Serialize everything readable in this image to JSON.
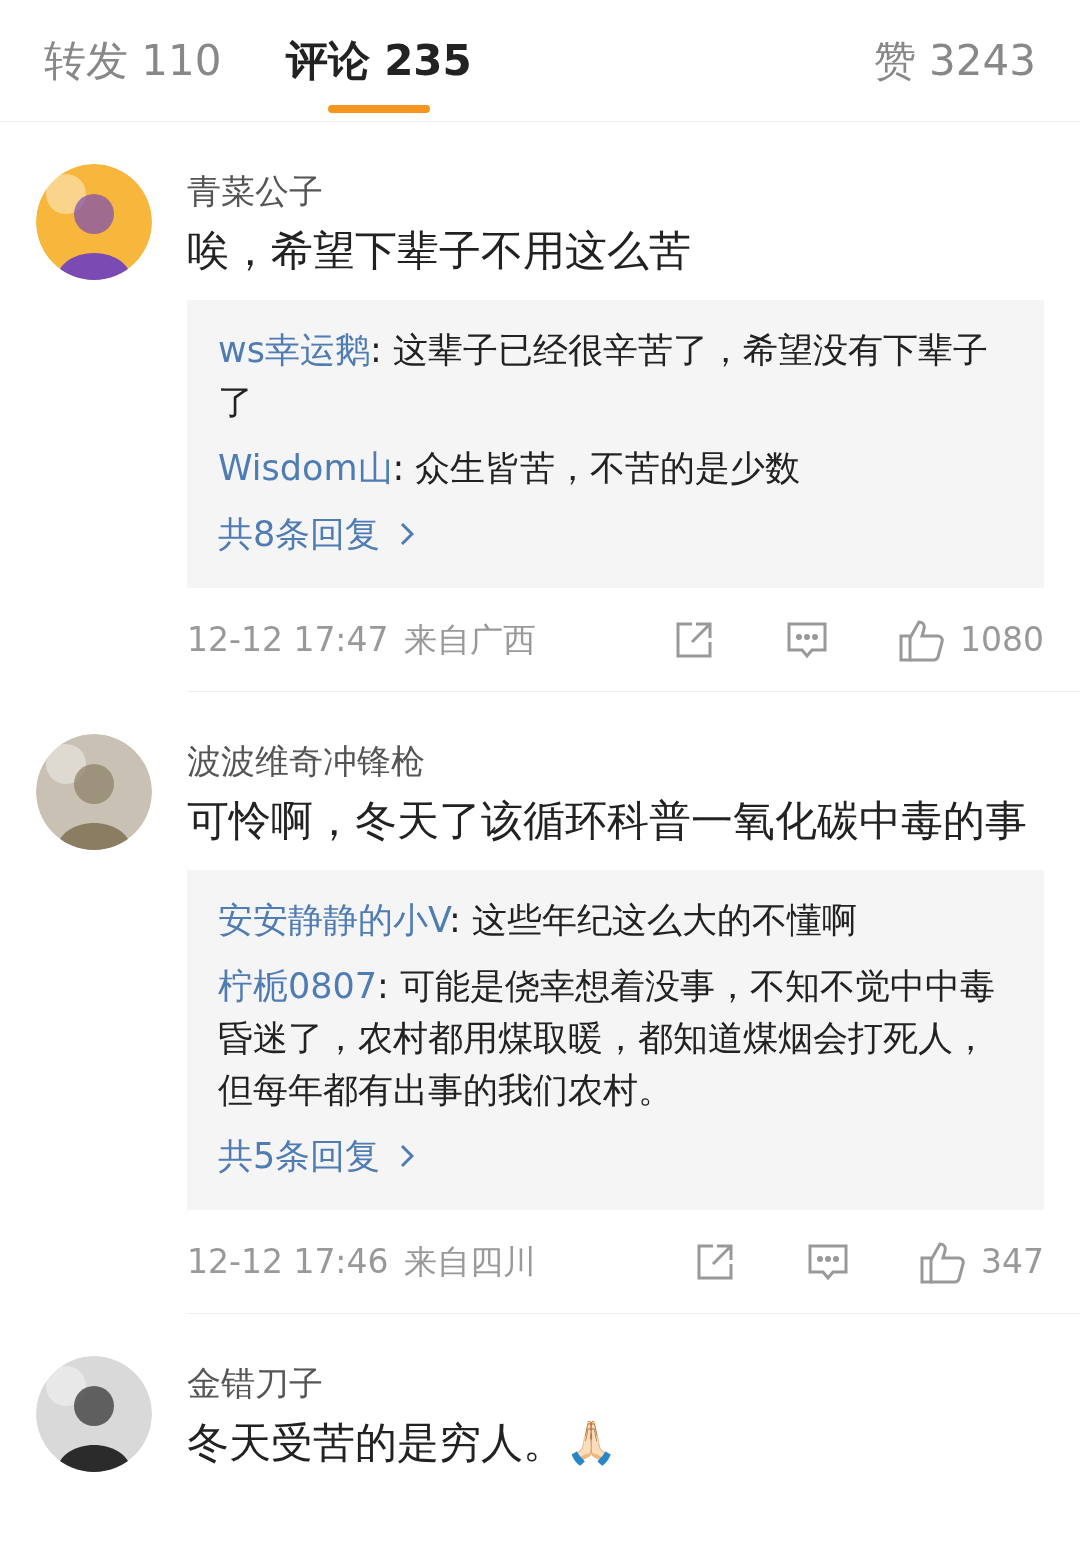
{
  "tabs": [
    {
      "label": "转发 110",
      "selected": false
    },
    {
      "label": "评论 235",
      "selected": true
    },
    {
      "label": "赞 3243",
      "selected": false
    }
  ],
  "comments": [
    {
      "user": "青菜公子",
      "text": "唉，希望下辈子不用这么苦",
      "replies": [
        {
          "author": "ws幸运鹅",
          "text": ": 这辈子已经很辛苦了，希望没有下辈子了"
        },
        {
          "author": "Wisdom山",
          "text": ": 众生皆苦，不苦的是少数"
        }
      ],
      "more": "共8条回复",
      "time": "12-12 17:47",
      "location": "来自广西",
      "likes": "1080"
    },
    {
      "user": "波波维奇冲锋枪",
      "text": "可怜啊，冬天了该循环科普一氧化碳中毒的事",
      "replies": [
        {
          "author": "安安静静的小V",
          "text": ": 这些年纪这么大的不懂啊"
        },
        {
          "author": "柠栀0807",
          "text": ": 可能是侥幸想着没事，不知不觉中中毒昏迷了，农村都用煤取暖，都知道煤烟会打死人，但每年都有出事的我们农村。"
        }
      ],
      "more": "共5条回复",
      "time": "12-12 17:46",
      "location": "来自四川",
      "likes": "347"
    },
    {
      "user": "金错刀子",
      "text": "冬天受苦的是穷人。🙏🏻"
    }
  ]
}
